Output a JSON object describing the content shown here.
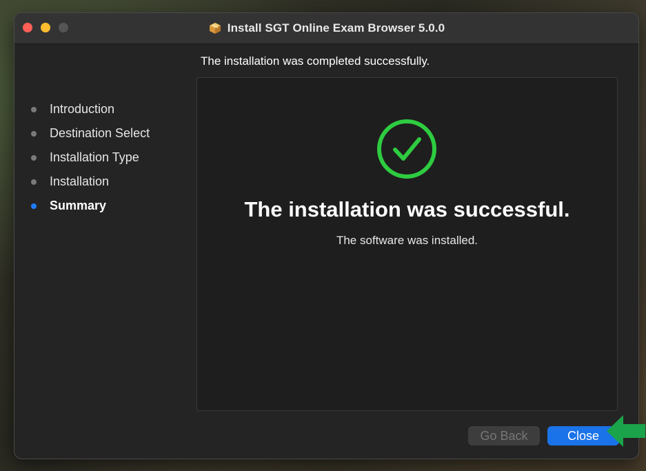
{
  "window": {
    "title": "Install SGT Online Exam Browser 5.0.0",
    "header_text": "The installation was completed successfully."
  },
  "sidebar": {
    "items": [
      {
        "label": "Introduction",
        "active": false
      },
      {
        "label": "Destination Select",
        "active": false
      },
      {
        "label": "Installation Type",
        "active": false
      },
      {
        "label": "Installation",
        "active": false
      },
      {
        "label": "Summary",
        "active": true
      }
    ]
  },
  "main": {
    "success_title": "The installation was successful.",
    "success_subtitle": "The software was installed."
  },
  "buttons": {
    "go_back": "Go Back",
    "close": "Close"
  },
  "icons": {
    "window_icon": "package-icon",
    "status_icon": "checkmark-circle-icon",
    "annotation": "arrow-left-icon"
  },
  "colors": {
    "accent": "#1a73e8",
    "active_step": "#1e7bff",
    "success": "#2ecc40",
    "annotation_arrow": "#1aa34a"
  }
}
